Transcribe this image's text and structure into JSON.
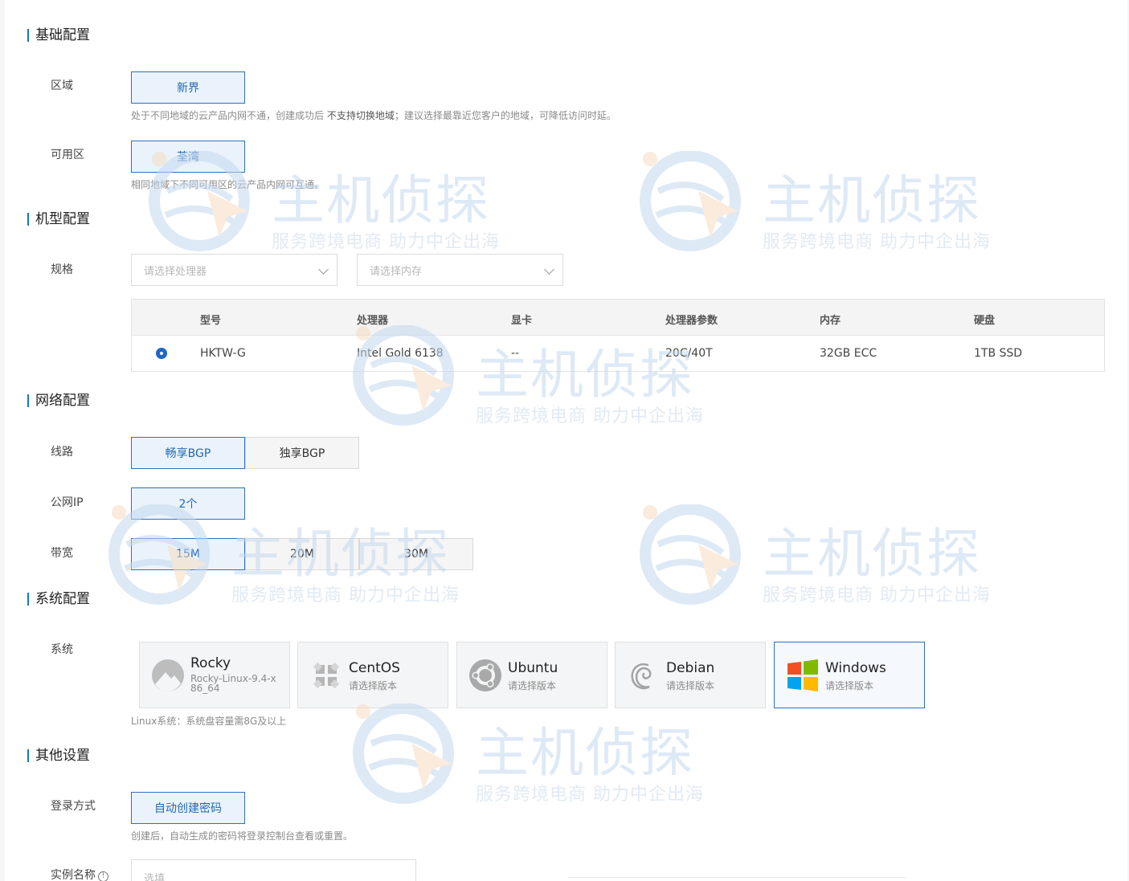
{
  "sections": {
    "basic": "基础配置",
    "model": "机型配置",
    "network": "网络配置",
    "system": "系统配置",
    "other": "其他设置"
  },
  "region": {
    "label": "区域",
    "option": "新界",
    "tip_prefix": "处于不同地域的云产品内网不通，创建成功后 ",
    "tip_bold": "不支持切换地域",
    "tip_suffix": "；建议选择最靠近您客户的地域，可降低访问时延。"
  },
  "zone": {
    "label": "可用区",
    "option": "荃湾",
    "tip": "相同地域下不同可用区的云产品内网可互通。"
  },
  "spec": {
    "label": "规格",
    "cpu_placeholder": "请选择处理器",
    "mem_placeholder": "请选择内存",
    "table": {
      "headers": [
        "型号",
        "处理器",
        "显卡",
        "处理器参数",
        "内存",
        "硬盘"
      ],
      "row": [
        "HKTW-G",
        "Intel Gold 6138",
        "--",
        "20C/40T",
        "32GB ECC",
        "1TB SSD"
      ]
    }
  },
  "line": {
    "label": "线路",
    "options": [
      "畅享BGP",
      "独享BGP"
    ],
    "selected": "畅享BGP"
  },
  "public_ip": {
    "label": "公网IP",
    "option": "2个"
  },
  "bandwidth": {
    "label": "带宽",
    "options": [
      "15M",
      "20M",
      "30M"
    ],
    "selected": "15M"
  },
  "system": {
    "label": "系统",
    "os": [
      {
        "name": "Rocky",
        "version": "Rocky-Linux-9.4-x86_64",
        "icon": "rocky-icon"
      },
      {
        "name": "CentOS",
        "version": "请选择版本",
        "icon": "centos-icon"
      },
      {
        "name": "Ubuntu",
        "version": "请选择版本",
        "icon": "ubuntu-icon"
      },
      {
        "name": "Debian",
        "version": "请选择版本",
        "icon": "debian-icon"
      },
      {
        "name": "Windows",
        "version": "请选择版本",
        "icon": "windows-icon"
      }
    ],
    "selected": "Windows",
    "tip": "Linux系统：系统盘容量需8G及以上"
  },
  "login": {
    "label": "登录方式",
    "option": "自动创建密码",
    "tip": "创建后，自动生成的密码将登录控制台查看或重置。"
  },
  "instance_name": {
    "label": "实例名称",
    "placeholder": "选填"
  },
  "watermark": {
    "main": "主机侦探",
    "slogan": "服务跨境电商 助力中企出海"
  },
  "colors": {
    "accent": "#2f6fbd",
    "selected_bg": "#eaf3fc",
    "section_bar": "#1677c9"
  }
}
